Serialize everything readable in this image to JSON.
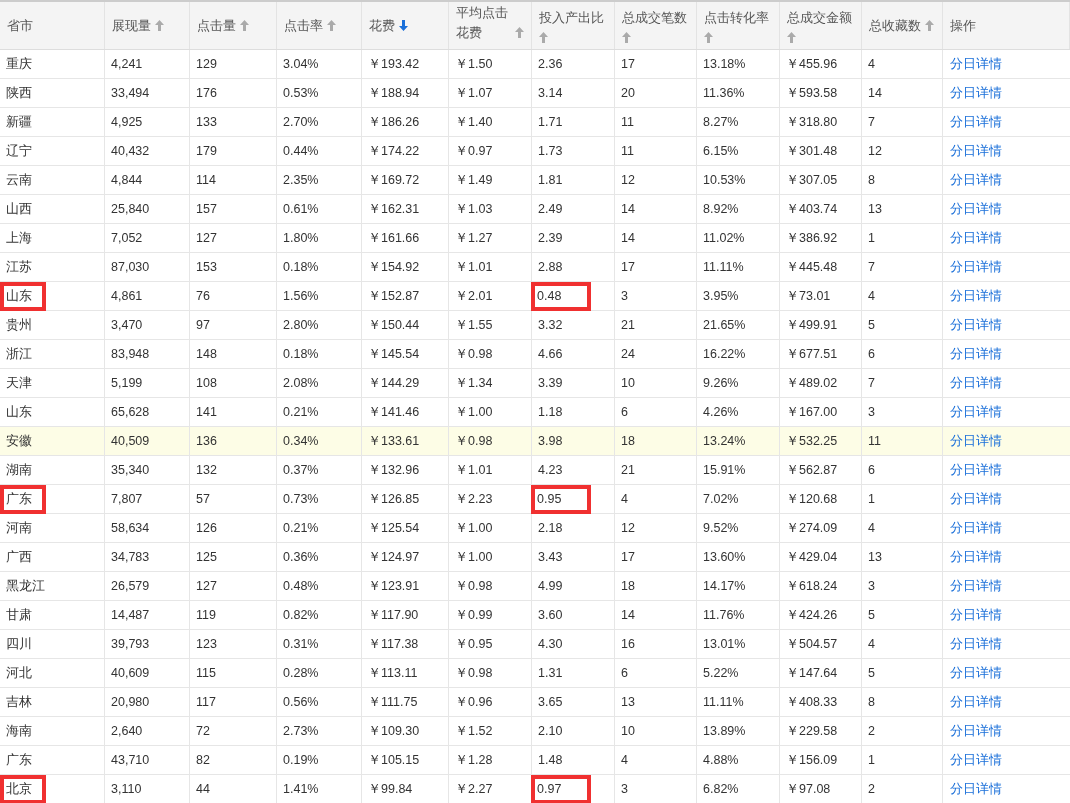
{
  "columns": [
    {
      "label": "省市",
      "sortable": false,
      "sorted": false
    },
    {
      "label": "展现量",
      "sortable": true,
      "sorted": false
    },
    {
      "label": "点击量",
      "sortable": true,
      "sorted": false
    },
    {
      "label": "点击率",
      "sortable": true,
      "sorted": false
    },
    {
      "label": "花费",
      "sortable": true,
      "sorted": true
    },
    {
      "label": "平均点击花费",
      "sortable": true,
      "sorted": false
    },
    {
      "label": "投入产出比",
      "sortable": true,
      "sorted": false
    },
    {
      "label": "总成交笔数",
      "sortable": true,
      "sorted": false
    },
    {
      "label": "点击转化率",
      "sortable": true,
      "sorted": false
    },
    {
      "label": "总成交金额",
      "sortable": true,
      "sorted": false
    },
    {
      "label": "总收藏数",
      "sortable": true,
      "sorted": false
    },
    {
      "label": "操作",
      "sortable": false,
      "sorted": false
    }
  ],
  "rows": [
    {
      "cells": [
        "重庆",
        "4,241",
        "129",
        "3.04%",
        "￥193.42",
        "￥1.50",
        "2.36",
        "17",
        "13.18%",
        "￥455.96",
        "4"
      ],
      "link": "分日详情",
      "highlighted": false,
      "province_flagged": false,
      "roi_flagged": false
    },
    {
      "cells": [
        "陕西",
        "33,494",
        "176",
        "0.53%",
        "￥188.94",
        "￥1.07",
        "3.14",
        "20",
        "11.36%",
        "￥593.58",
        "14"
      ],
      "link": "分日详情",
      "highlighted": false,
      "province_flagged": false,
      "roi_flagged": false
    },
    {
      "cells": [
        "新疆",
        "4,925",
        "133",
        "2.70%",
        "￥186.26",
        "￥1.40",
        "1.71",
        "11",
        "8.27%",
        "￥318.80",
        "7"
      ],
      "link": "分日详情",
      "highlighted": false,
      "province_flagged": false,
      "roi_flagged": false
    },
    {
      "cells": [
        "辽宁",
        "40,432",
        "179",
        "0.44%",
        "￥174.22",
        "￥0.97",
        "1.73",
        "11",
        "6.15%",
        "￥301.48",
        "12"
      ],
      "link": "分日详情",
      "highlighted": false,
      "province_flagged": false,
      "roi_flagged": false
    },
    {
      "cells": [
        "云南",
        "4,844",
        "114",
        "2.35%",
        "￥169.72",
        "￥1.49",
        "1.81",
        "12",
        "10.53%",
        "￥307.05",
        "8"
      ],
      "link": "分日详情",
      "highlighted": false,
      "province_flagged": false,
      "roi_flagged": false
    },
    {
      "cells": [
        "山西",
        "25,840",
        "157",
        "0.61%",
        "￥162.31",
        "￥1.03",
        "2.49",
        "14",
        "8.92%",
        "￥403.74",
        "13"
      ],
      "link": "分日详情",
      "highlighted": false,
      "province_flagged": false,
      "roi_flagged": false
    },
    {
      "cells": [
        "上海",
        "7,052",
        "127",
        "1.80%",
        "￥161.66",
        "￥1.27",
        "2.39",
        "14",
        "11.02%",
        "￥386.92",
        "1"
      ],
      "link": "分日详情",
      "highlighted": false,
      "province_flagged": false,
      "roi_flagged": false
    },
    {
      "cells": [
        "江苏",
        "87,030",
        "153",
        "0.18%",
        "￥154.92",
        "￥1.01",
        "2.88",
        "17",
        "11.11%",
        "￥445.48",
        "7"
      ],
      "link": "分日详情",
      "highlighted": false,
      "province_flagged": false,
      "roi_flagged": false
    },
    {
      "cells": [
        "山东",
        "4,861",
        "76",
        "1.56%",
        "￥152.87",
        "￥2.01",
        "0.48",
        "3",
        "3.95%",
        "￥73.01",
        "4"
      ],
      "link": "分日详情",
      "highlighted": false,
      "province_flagged": true,
      "roi_flagged": true
    },
    {
      "cells": [
        "贵州",
        "3,470",
        "97",
        "2.80%",
        "￥150.44",
        "￥1.55",
        "3.32",
        "21",
        "21.65%",
        "￥499.91",
        "5"
      ],
      "link": "分日详情",
      "highlighted": false,
      "province_flagged": false,
      "roi_flagged": false
    },
    {
      "cells": [
        "浙江",
        "83,948",
        "148",
        "0.18%",
        "￥145.54",
        "￥0.98",
        "4.66",
        "24",
        "16.22%",
        "￥677.51",
        "6"
      ],
      "link": "分日详情",
      "highlighted": false,
      "province_flagged": false,
      "roi_flagged": false
    },
    {
      "cells": [
        "天津",
        "5,199",
        "108",
        "2.08%",
        "￥144.29",
        "￥1.34",
        "3.39",
        "10",
        "9.26%",
        "￥489.02",
        "7"
      ],
      "link": "分日详情",
      "highlighted": false,
      "province_flagged": false,
      "roi_flagged": false
    },
    {
      "cells": [
        "山东",
        "65,628",
        "141",
        "0.21%",
        "￥141.46",
        "￥1.00",
        "1.18",
        "6",
        "4.26%",
        "￥167.00",
        "3"
      ],
      "link": "分日详情",
      "highlighted": false,
      "province_flagged": false,
      "roi_flagged": false
    },
    {
      "cells": [
        "安徽",
        "40,509",
        "136",
        "0.34%",
        "￥133.61",
        "￥0.98",
        "3.98",
        "18",
        "13.24%",
        "￥532.25",
        "11"
      ],
      "link": "分日详情",
      "highlighted": true,
      "province_flagged": false,
      "roi_flagged": false
    },
    {
      "cells": [
        "湖南",
        "35,340",
        "132",
        "0.37%",
        "￥132.96",
        "￥1.01",
        "4.23",
        "21",
        "15.91%",
        "￥562.87",
        "6"
      ],
      "link": "分日详情",
      "highlighted": false,
      "province_flagged": false,
      "roi_flagged": false
    },
    {
      "cells": [
        "广东",
        "7,807",
        "57",
        "0.73%",
        "￥126.85",
        "￥2.23",
        "0.95",
        "4",
        "7.02%",
        "￥120.68",
        "1"
      ],
      "link": "分日详情",
      "highlighted": false,
      "province_flagged": true,
      "roi_flagged": true
    },
    {
      "cells": [
        "河南",
        "58,634",
        "126",
        "0.21%",
        "￥125.54",
        "￥1.00",
        "2.18",
        "12",
        "9.52%",
        "￥274.09",
        "4"
      ],
      "link": "分日详情",
      "highlighted": false,
      "province_flagged": false,
      "roi_flagged": false
    },
    {
      "cells": [
        "广西",
        "34,783",
        "125",
        "0.36%",
        "￥124.97",
        "￥1.00",
        "3.43",
        "17",
        "13.60%",
        "￥429.04",
        "13"
      ],
      "link": "分日详情",
      "highlighted": false,
      "province_flagged": false,
      "roi_flagged": false
    },
    {
      "cells": [
        "黑龙江",
        "26,579",
        "127",
        "0.48%",
        "￥123.91",
        "￥0.98",
        "4.99",
        "18",
        "14.17%",
        "￥618.24",
        "3"
      ],
      "link": "分日详情",
      "highlighted": false,
      "province_flagged": false,
      "roi_flagged": false
    },
    {
      "cells": [
        "甘肃",
        "14,487",
        "119",
        "0.82%",
        "￥117.90",
        "￥0.99",
        "3.60",
        "14",
        "11.76%",
        "￥424.26",
        "5"
      ],
      "link": "分日详情",
      "highlighted": false,
      "province_flagged": false,
      "roi_flagged": false
    },
    {
      "cells": [
        "四川",
        "39,793",
        "123",
        "0.31%",
        "￥117.38",
        "￥0.95",
        "4.30",
        "16",
        "13.01%",
        "￥504.57",
        "4"
      ],
      "link": "分日详情",
      "highlighted": false,
      "province_flagged": false,
      "roi_flagged": false
    },
    {
      "cells": [
        "河北",
        "40,609",
        "115",
        "0.28%",
        "￥113.11",
        "￥0.98",
        "1.31",
        "6",
        "5.22%",
        "￥147.64",
        "5"
      ],
      "link": "分日详情",
      "highlighted": false,
      "province_flagged": false,
      "roi_flagged": false
    },
    {
      "cells": [
        "吉林",
        "20,980",
        "117",
        "0.56%",
        "￥111.75",
        "￥0.96",
        "3.65",
        "13",
        "11.11%",
        "￥408.33",
        "8"
      ],
      "link": "分日详情",
      "highlighted": false,
      "province_flagged": false,
      "roi_flagged": false
    },
    {
      "cells": [
        "海南",
        "2,640",
        "72",
        "2.73%",
        "￥109.30",
        "￥1.52",
        "2.10",
        "10",
        "13.89%",
        "￥229.58",
        "2"
      ],
      "link": "分日详情",
      "highlighted": false,
      "province_flagged": false,
      "roi_flagged": false
    },
    {
      "cells": [
        "广东",
        "43,710",
        "82",
        "0.19%",
        "￥105.15",
        "￥1.28",
        "1.48",
        "4",
        "4.88%",
        "￥156.09",
        "1"
      ],
      "link": "分日详情",
      "highlighted": false,
      "province_flagged": false,
      "roi_flagged": false
    },
    {
      "cells": [
        "北京",
        "3,110",
        "44",
        "1.41%",
        "￥99.84",
        "￥2.27",
        "0.97",
        "3",
        "6.82%",
        "￥97.08",
        "2"
      ],
      "link": "分日详情",
      "highlighted": false,
      "province_flagged": true,
      "roi_flagged": true
    }
  ]
}
